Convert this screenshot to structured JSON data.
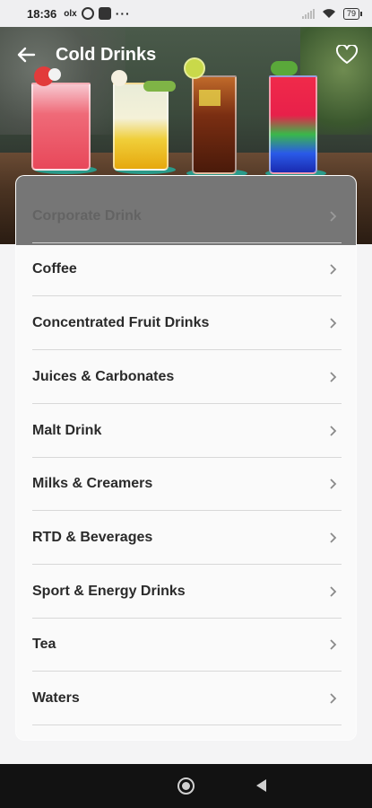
{
  "status_bar": {
    "time": "18:36",
    "notification_icons": [
      "olx-icon",
      "whatsapp-icon",
      "app-icon"
    ],
    "more": "···",
    "battery": "79"
  },
  "header": {
    "title": "Cold Drinks"
  },
  "categories": [
    {
      "label": "Corporate Drink"
    },
    {
      "label": "Coffee"
    },
    {
      "label": "Concentrated Fruit Drinks"
    },
    {
      "label": "Juices & Carbonates"
    },
    {
      "label": "Malt Drink"
    },
    {
      "label": "Milks & Creamers"
    },
    {
      "label": "RTD & Beverages"
    },
    {
      "label": "Sport & Energy Drinks"
    },
    {
      "label": "Tea"
    },
    {
      "label": "Waters"
    }
  ],
  "colors": {
    "card_bg": "#fafafa",
    "text": "#2a2a2a",
    "divider": "#d8d8d8",
    "nav_bar": "#121212"
  }
}
